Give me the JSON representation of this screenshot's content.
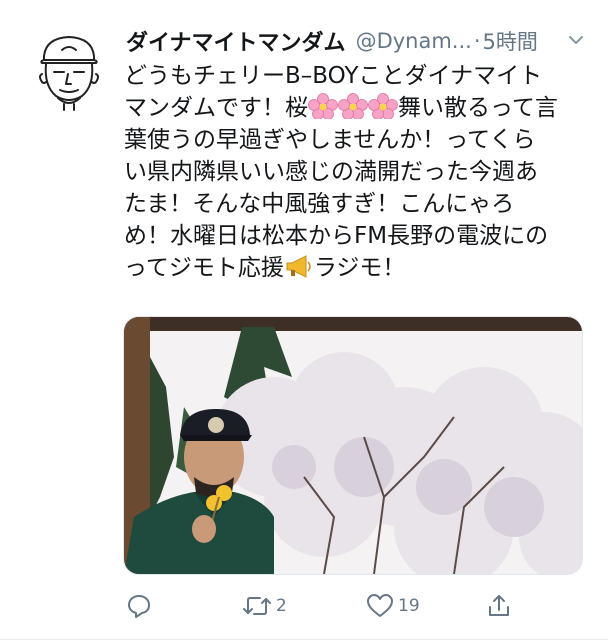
{
  "tweet": {
    "display_name": "ダイナマイトマンダム",
    "handle": "@Dynam...",
    "separator": "·",
    "time": "5時間",
    "body_lines": [
      "どうもチェリーB–BOYことダイナマイト",
      "マンダムです！桜",
      "舞い散るって言",
      "葉使うの早過ぎやしませんか！ってくら",
      "い県内隣県いい感じの満開だった今週あ",
      "たま！そんな中風強すぎ！こんにゃろ",
      "め！水曜日は松本からFM長野の電波にの",
      "ってジモト応援",
      "ラジモ！"
    ],
    "icons": {
      "cherry_blossom": "cherry-blossom-icon",
      "megaphone": "megaphone-icon"
    },
    "actions": {
      "reply_count": "",
      "retweet_count": "2",
      "like_count": "19"
    }
  },
  "colors": {
    "text": "#14171a",
    "secondary": "#657786",
    "blossom": "#f6a3c7"
  }
}
